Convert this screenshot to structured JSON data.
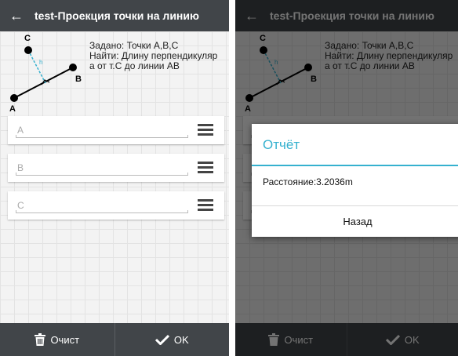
{
  "app": {
    "title": "test-Проекция точки на линию"
  },
  "task": {
    "given": "Задано: Точки А,В,С",
    "find_line1": "Найти: Длину перпендикуляр",
    "find_line2": "а от т.С до линии АВ"
  },
  "diagram": {
    "point_a": "A",
    "point_b": "B",
    "point_c": "C",
    "perp_label": "h"
  },
  "fields": [
    {
      "placeholder": "A"
    },
    {
      "placeholder": "B"
    },
    {
      "placeholder": "C"
    }
  ],
  "bottom": {
    "clear_label": "Очист",
    "ok_label": "OK"
  },
  "dialog": {
    "title": "Отчёт",
    "message": "Расстояние:3.2036m",
    "back_label": "Назад"
  },
  "colors": {
    "appbar": "#414549",
    "accent": "#35b1cf",
    "perpendicular": "#35b1cf"
  },
  "icons": {
    "back": "arrow-left-icon",
    "list": "list-icon",
    "clear": "trash-icon",
    "ok": "checkmark-icon"
  }
}
